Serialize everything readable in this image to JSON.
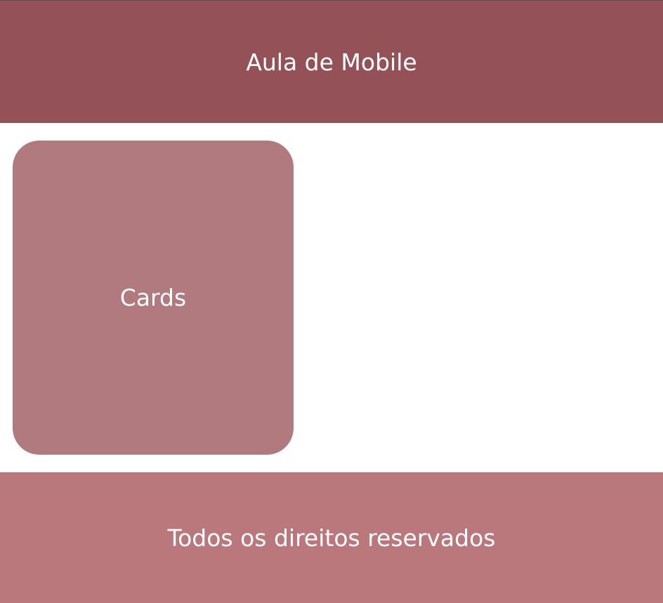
{
  "header": {
    "title": "Aula de Mobile"
  },
  "main": {
    "card_label": "Cards"
  },
  "footer": {
    "text": "Todos os direitos reservados"
  },
  "colors": {
    "header_bg": "#955158",
    "card_bg": "#b07a7e",
    "footer_bg": "#ba787d",
    "text": "#ffffff"
  }
}
